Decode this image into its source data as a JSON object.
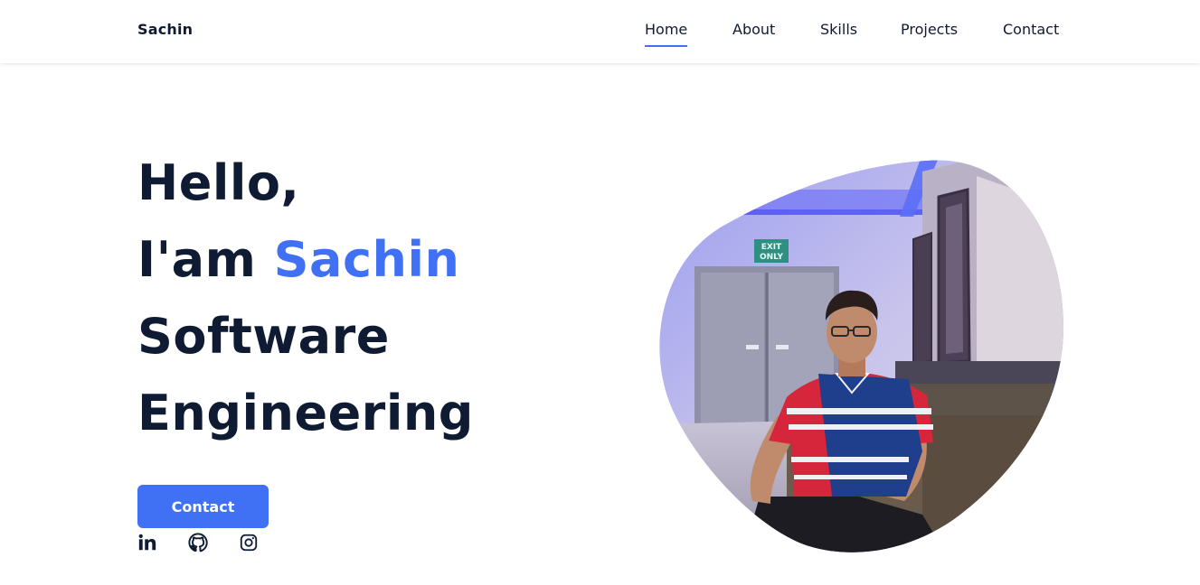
{
  "header": {
    "logo": "Sachin",
    "nav": [
      {
        "label": "Home",
        "active": true
      },
      {
        "label": "About",
        "active": false
      },
      {
        "label": "Skills",
        "active": false
      },
      {
        "label": "Projects",
        "active": false
      },
      {
        "label": "Contact",
        "active": false
      }
    ]
  },
  "hero": {
    "greeting": "Hello,",
    "intro_prefix": "I'am",
    "name": "Sachin",
    "role_line1": "Software",
    "role_line2": "Engineering",
    "button_label": "Contact"
  },
  "socials": [
    {
      "icon": "linkedin-icon"
    },
    {
      "icon": "github-icon"
    },
    {
      "icon": "instagram-icon"
    }
  ],
  "photo": {
    "sign_text_1": "EXIT",
    "sign_text_2": "ONLY"
  },
  "colors": {
    "accent": "#4070f4",
    "text": "#0e1b33",
    "background": "#ffffff"
  }
}
